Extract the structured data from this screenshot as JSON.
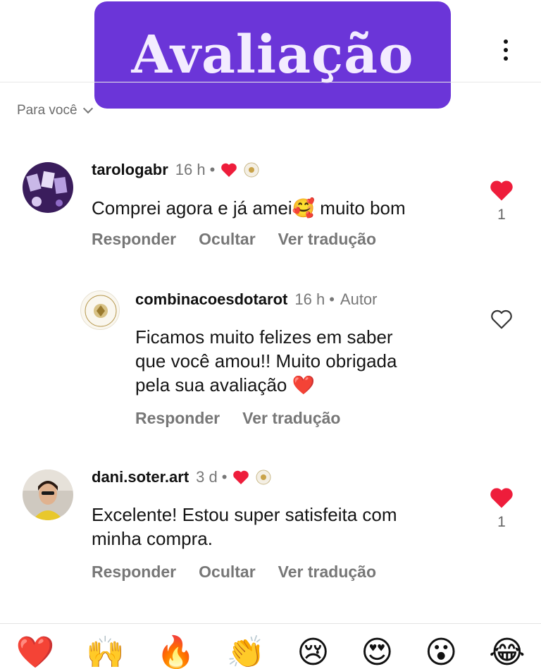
{
  "banner": {
    "title": "Avaliação"
  },
  "filter": {
    "label": "Para você"
  },
  "comments": [
    {
      "username": "tarologabr",
      "time": "16 h",
      "text": "Comprei agora e já amei🥰 muito bom",
      "actions": [
        "Responder",
        "Ocultar",
        "Ver tradução"
      ],
      "likes": "1",
      "liked": true
    },
    {
      "username": "combinacoesdotarot",
      "time": "16 h",
      "badge": "Autor",
      "text_lines": [
        "Ficamos muito felizes em saber",
        "que você amou!! Muito obrigada",
        "pela sua avaliação ❤️"
      ],
      "actions": [
        "Responder",
        "Ver tradução"
      ],
      "liked": false
    },
    {
      "username": "dani.soter.art",
      "time": "3 d",
      "text_lines": [
        "Excelente! Estou super satisfeita com",
        "minha compra."
      ],
      "actions": [
        "Responder",
        "Ocultar",
        "Ver tradução"
      ],
      "likes": "1",
      "liked": true
    }
  ],
  "reactions": [
    "❤️",
    "🙌",
    "🔥",
    "👏",
    "😢",
    "😍",
    "😮",
    "😂"
  ],
  "colors": {
    "banner": "#6b35d8",
    "heart": "#ee1d3b",
    "muted": "#777777"
  }
}
